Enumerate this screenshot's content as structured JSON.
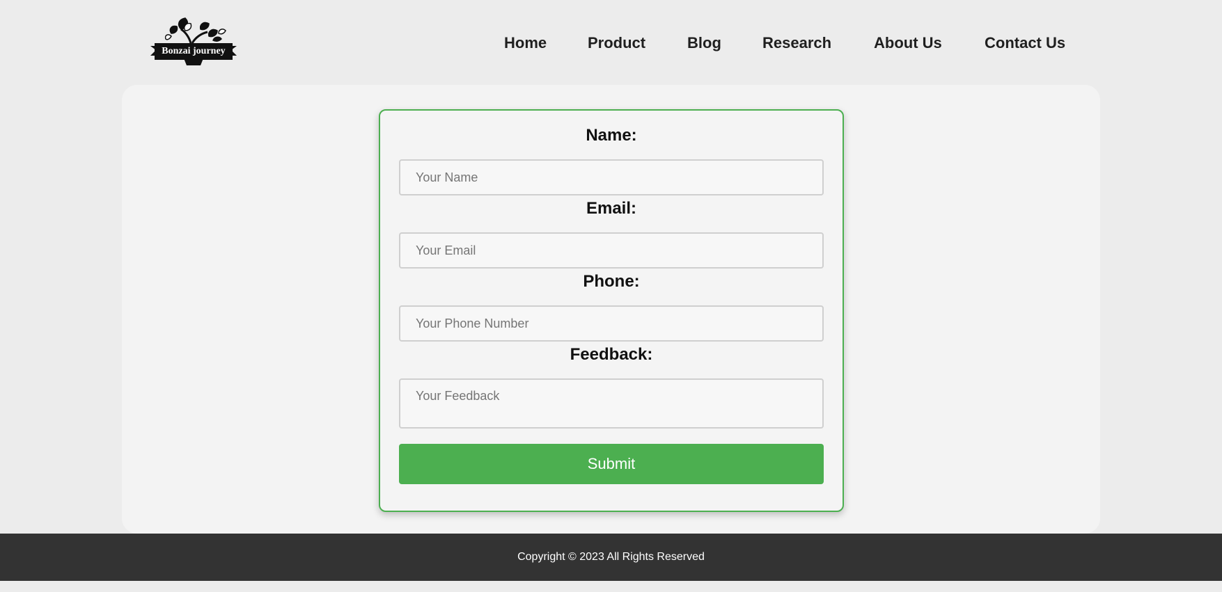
{
  "header": {
    "logo_text": "Bonzai journey",
    "nav": [
      {
        "label": "Home"
      },
      {
        "label": "Product"
      },
      {
        "label": "Blog"
      },
      {
        "label": "Research"
      },
      {
        "label": "About Us"
      },
      {
        "label": "Contact Us"
      }
    ]
  },
  "form": {
    "name": {
      "label": "Name:",
      "placeholder": "Your Name",
      "value": ""
    },
    "email": {
      "label": "Email:",
      "placeholder": "Your Email",
      "value": ""
    },
    "phone": {
      "label": "Phone:",
      "placeholder": "Your Phone Number",
      "value": ""
    },
    "feedback": {
      "label": "Feedback:",
      "placeholder": "Your Feedback",
      "value": ""
    },
    "submit_label": "Submit"
  },
  "footer": {
    "copyright": "Copyright © 2023 All Rights Reserved"
  },
  "colors": {
    "accent": "#4caf50",
    "footer_bg": "#333333",
    "page_bg": "#ececec",
    "card_bg": "#f3f3f3"
  }
}
